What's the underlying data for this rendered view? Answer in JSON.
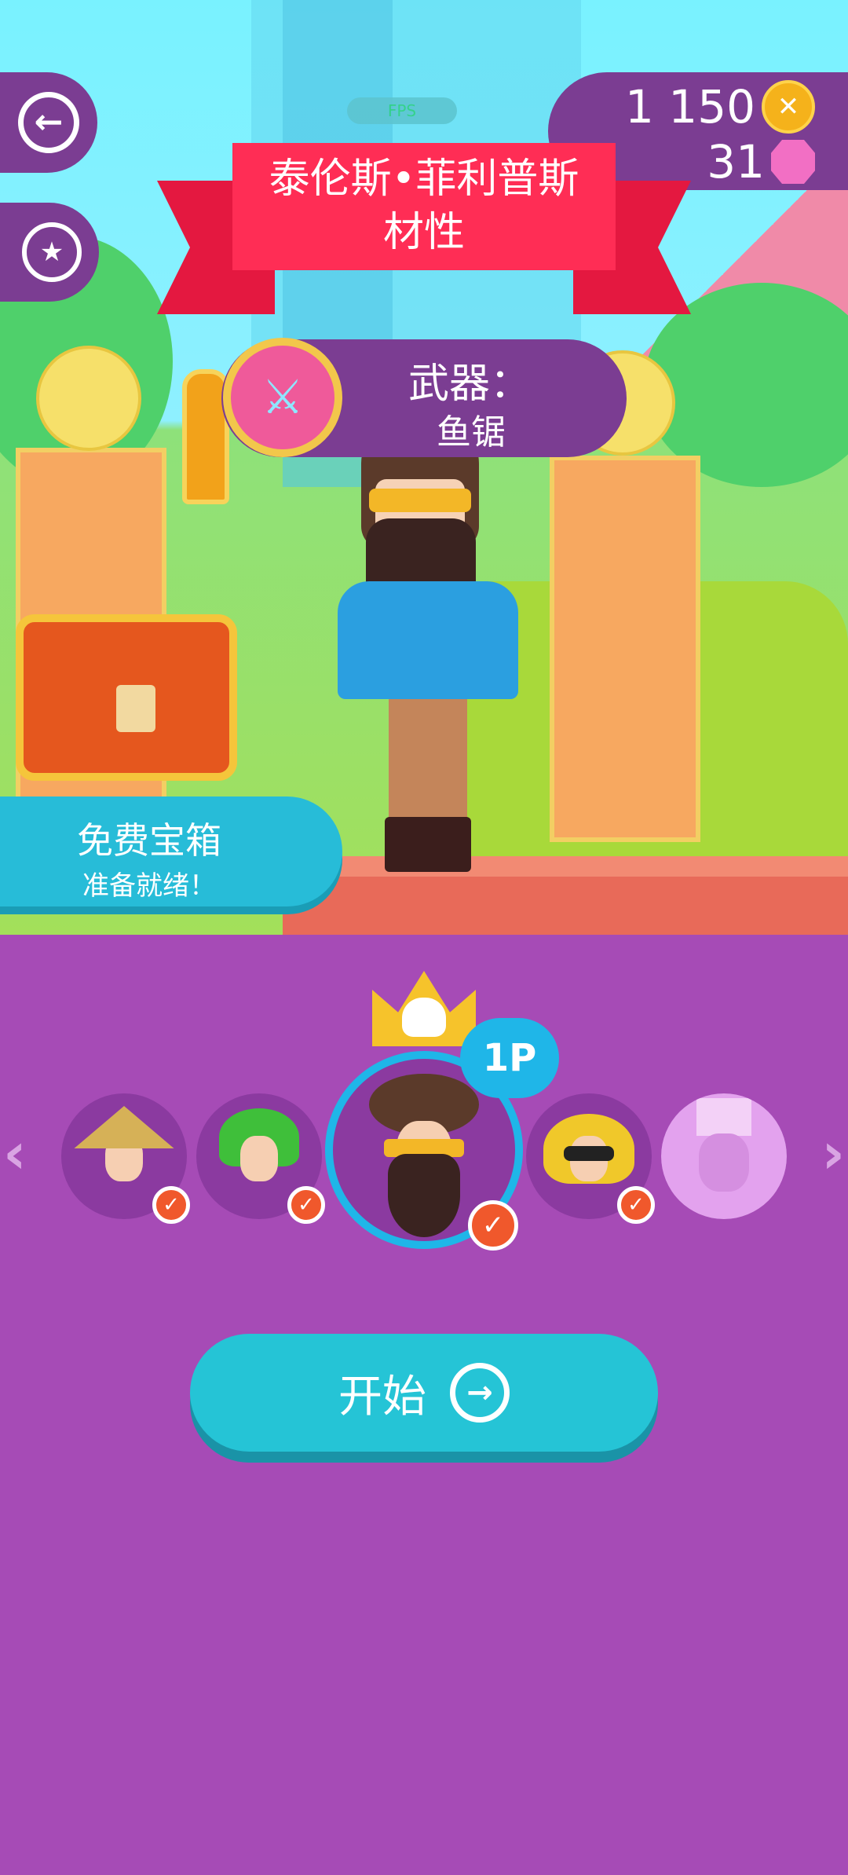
{
  "top": {
    "back_glyph": "←",
    "badge_glyph": "★",
    "fps_label": "FPS",
    "coins": "1 150",
    "coin_glyph": "✕",
    "gems": "31"
  },
  "banner": {
    "name_line1": "泰伦斯•菲利普斯",
    "name_line2": "材性"
  },
  "weapon": {
    "title": "武器：",
    "name": "鱼锯",
    "icon_glyph": "⚔"
  },
  "free_chest": {
    "title": "免费宝箱",
    "subtitle": "准备就绪！"
  },
  "carousel": {
    "left_arrow": "‹",
    "right_arrow": "›",
    "selected_tag": "1P",
    "check_glyph": "✓"
  },
  "start_button": {
    "label": "开始",
    "arrow_glyph": "→"
  },
  "colors": {
    "panel": "#7b3d92",
    "lower_bg": "#a64bb6",
    "accent_cyan": "#25c4d6",
    "banner_red": "#ff2d55",
    "check_orange": "#f0582c",
    "selected_ring": "#1fb6e8"
  }
}
